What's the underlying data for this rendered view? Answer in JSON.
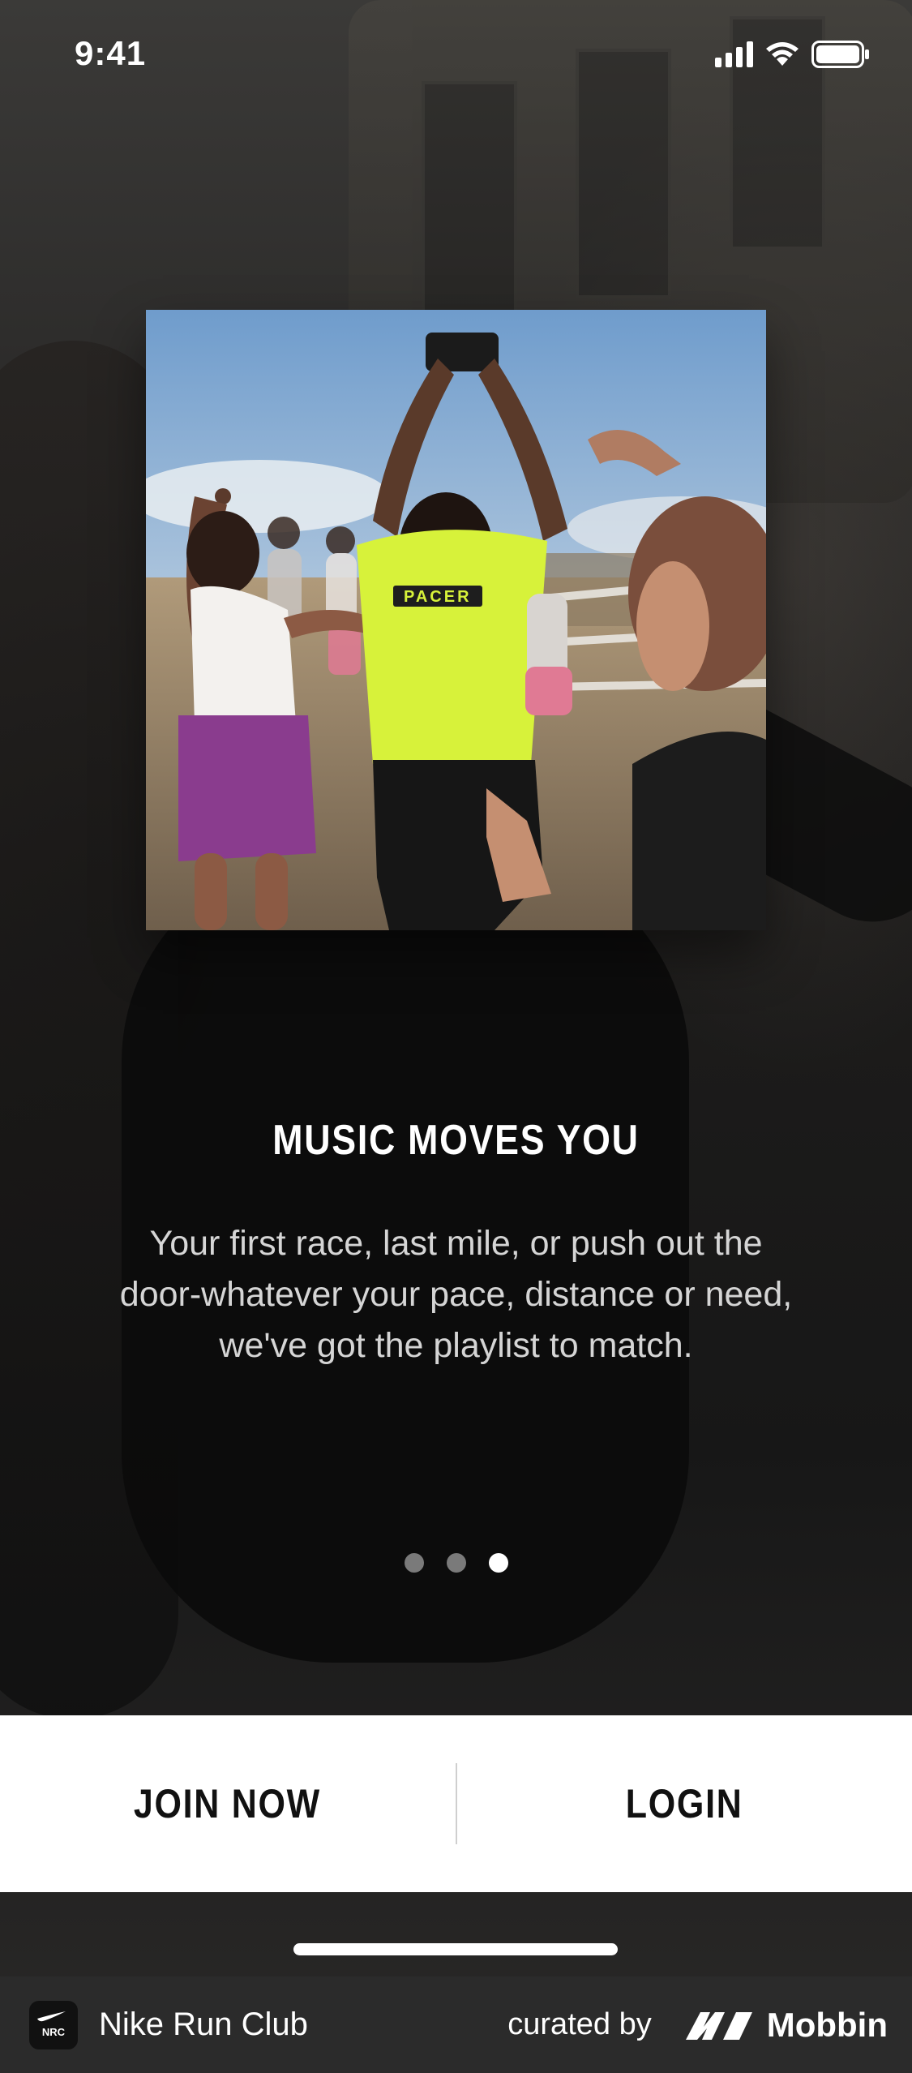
{
  "status_bar": {
    "time": "9:41"
  },
  "onboarding": {
    "headline": "MUSIC MOVES YOU",
    "body": "Your first race, last mile, or push out the door-whatever your pace, distance or need, we've got the playlist to match.",
    "page_indicator": {
      "total": 3,
      "active_index": 2
    }
  },
  "actions": {
    "join_label": "JOIN NOW",
    "login_label": "LOGIN"
  },
  "footer": {
    "app_name": "Nike Run Club",
    "app_icon_text": "NRC",
    "curated_by": "curated by",
    "brand": "Mobbin"
  },
  "colors": {
    "button_background": "#ffffff",
    "footer_background": "#2b2b2b",
    "shirt_accent": "#d7f23a"
  }
}
